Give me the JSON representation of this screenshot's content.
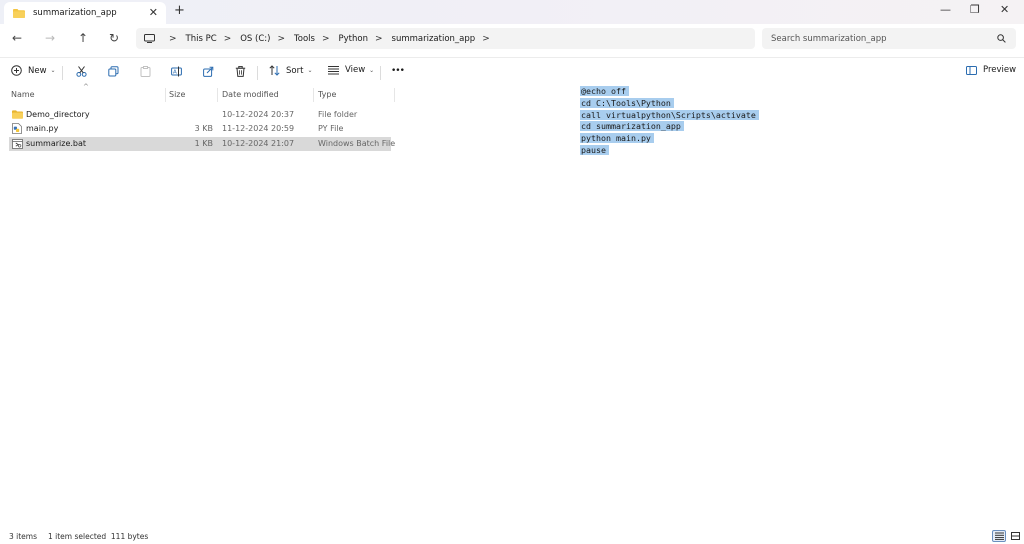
{
  "window": {
    "tab_title": "summarization_app",
    "close_tab_glyph": "✕",
    "new_tab_glyph": "+",
    "controls": {
      "minimize": "—",
      "maximize": "❐",
      "close": "✕"
    }
  },
  "nav": {
    "back": "←",
    "forward": "→",
    "up": "↑",
    "refresh": "↻",
    "separator": ">",
    "breadcrumbs": [
      "This PC",
      "OS (C:)",
      "Tools",
      "Python",
      "summarization_app"
    ],
    "search_placeholder": "Search summarization_app"
  },
  "toolbar": {
    "new_label": "New",
    "sort_label": "Sort",
    "view_label": "View",
    "more_label": "•••",
    "preview_label": "Preview",
    "dropdown_glyph": "⌄"
  },
  "file_list": {
    "columns": {
      "name": "Name",
      "size": "Size",
      "date": "Date modified",
      "type": "Type"
    },
    "sort_indicator": "^",
    "rows": [
      {
        "name": "Demo_directory",
        "size": "",
        "date": "10-12-2024 20:37",
        "type": "File folder",
        "icon": "folder-icon",
        "selected": false
      },
      {
        "name": "main.py",
        "size": "3 KB",
        "date": "11-12-2024 20:59",
        "type": "PY File",
        "icon": "python-file-icon",
        "selected": false
      },
      {
        "name": "summarize.bat",
        "size": "1 KB",
        "date": "10-12-2024 21:07",
        "type": "Windows Batch File",
        "icon": "batch-file-icon",
        "selected": true
      }
    ]
  },
  "preview": {
    "lines": [
      "@echo off",
      "cd C:\\Tools\\Python",
      "call virtualpython\\Scripts\\activate",
      "cd summarization_app",
      "python main.py",
      "pause"
    ]
  },
  "status": {
    "item_count": "3 items",
    "selection": "1 item selected  111 bytes"
  },
  "colors": {
    "selection_row": "#d9d9d9",
    "code_highlight": "#a8cdee",
    "folder": "#f4c542",
    "accent": "#0067c0"
  }
}
